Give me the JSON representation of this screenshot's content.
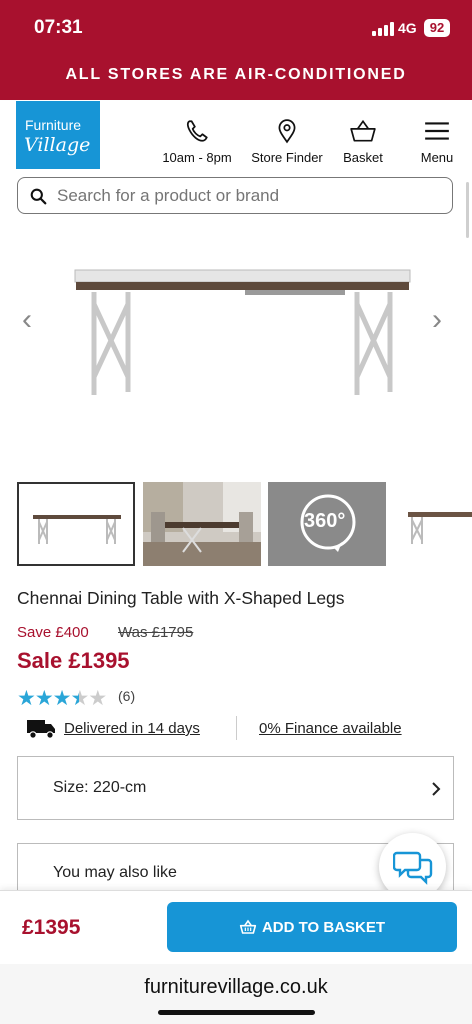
{
  "status_bar": {
    "time": "07:31",
    "network": "4G",
    "battery": "92"
  },
  "promo_banner": "ALL STORES ARE AIR-CONDITIONED",
  "brand": {
    "line1": "Furniture",
    "line2": "Village",
    "color": "#1795d6"
  },
  "header_nav": [
    {
      "label": "10am - 8pm",
      "icon": "phone-icon"
    },
    {
      "label": "Store Finder",
      "icon": "location-pin-icon"
    },
    {
      "label": "Basket",
      "icon": "basket-icon"
    },
    {
      "label": "Menu",
      "icon": "hamburger-menu-icon"
    }
  ],
  "search": {
    "placeholder": "Search for a product or brand"
  },
  "carousel": {
    "prev": "‹",
    "next": "›",
    "thumbnail_360_label": "360°"
  },
  "product": {
    "title": "Chennai Dining Table with X-Shaped Legs",
    "save": "Save £400",
    "was": "Was £1795",
    "sale": "Sale £1395",
    "rating": 3.5,
    "rating_max": 5,
    "review_count": "(6)",
    "delivery": "Delivered in 14 days",
    "finance": "0% Finance available",
    "size": "Size: 220-cm"
  },
  "also_like": "You may also like",
  "bottom_bar": {
    "price": "£1395",
    "add_button": "ADD TO BASKET"
  },
  "browser": {
    "url": "furniturevillage.co.uk"
  },
  "colors": {
    "brand_red": "#a8112e",
    "accent_blue": "#1795d6",
    "star_blue": "#2aa6d8"
  }
}
